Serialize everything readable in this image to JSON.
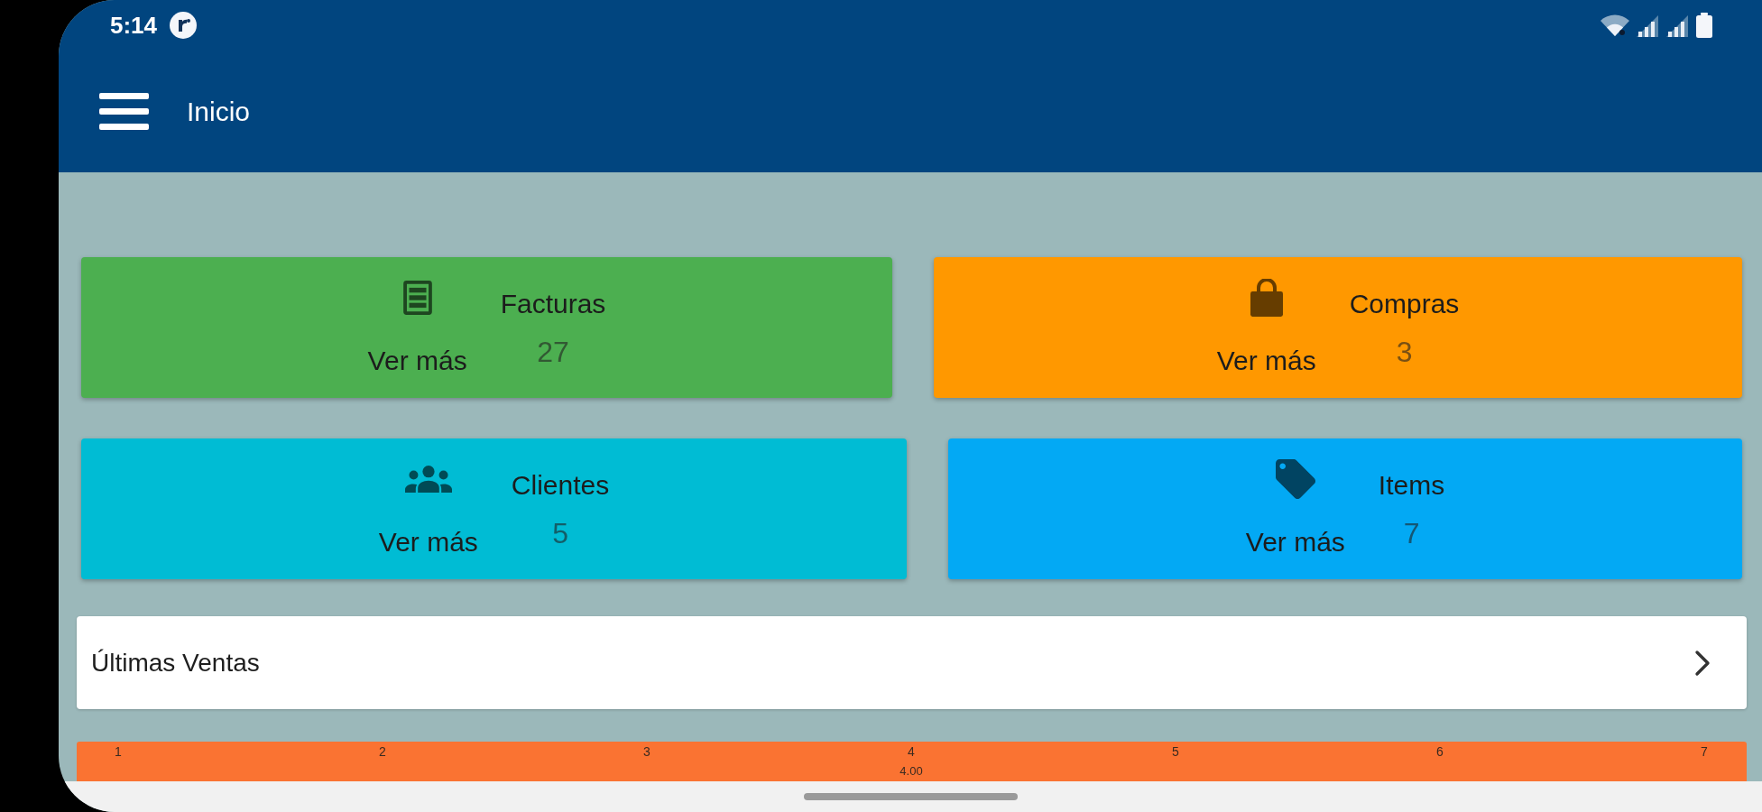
{
  "status_bar": {
    "time": "5:14"
  },
  "app_bar": {
    "title": "Inicio"
  },
  "cards": [
    {
      "title": "Facturas",
      "count": "27",
      "link": "Ver más",
      "color": "#4caf50"
    },
    {
      "title": "Compras",
      "count": "3",
      "link": "Ver más",
      "color": "#ff9800"
    },
    {
      "title": "Clientes",
      "count": "5",
      "link": "Ver más",
      "color": "#00bcd4"
    },
    {
      "title": "Items",
      "count": "7",
      "link": "Ver más",
      "color": "#03a9f4"
    }
  ],
  "latest_sales": {
    "title": "Últimas Ventas"
  },
  "sales_chart": {
    "ticks": [
      {
        "label": "1"
      },
      {
        "label": "2"
      },
      {
        "label": "3"
      },
      {
        "label": "4",
        "value_label": "4.00"
      },
      {
        "label": "5"
      },
      {
        "label": "6"
      },
      {
        "label": "7"
      }
    ]
  }
}
